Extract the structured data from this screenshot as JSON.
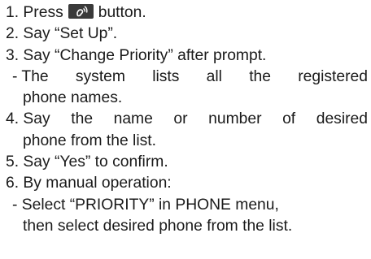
{
  "steps": {
    "s1_pre": "1. Press",
    "s1_post": "button.",
    "s2": "2. Say “Set Up”.",
    "s3": "3. Say “Change Priority” after prompt.",
    "s3_sub_l1_words": [
      "- The",
      "system",
      "lists",
      "all",
      "the",
      "registered"
    ],
    "s3_sub_l2": "phone names.",
    "s4_l1_words": [
      "4. Say",
      "the",
      "name",
      "or",
      "number",
      "of",
      "desired"
    ],
    "s4_l2": "phone from the list.",
    "s5": "5. Say “Yes” to confirm.",
    "s6": "6. By manual operation:",
    "s6_sub_l1": "- Select “PRIORITY” in PHONE menu,",
    "s6_sub_l2": "then select desired phone from the list."
  },
  "icons": {
    "voice_button": "voice-recognition-icon"
  },
  "colors": {
    "text": "#1a1a1a",
    "button_bg": "#3a3a3a",
    "button_fg": "#ffffff"
  }
}
